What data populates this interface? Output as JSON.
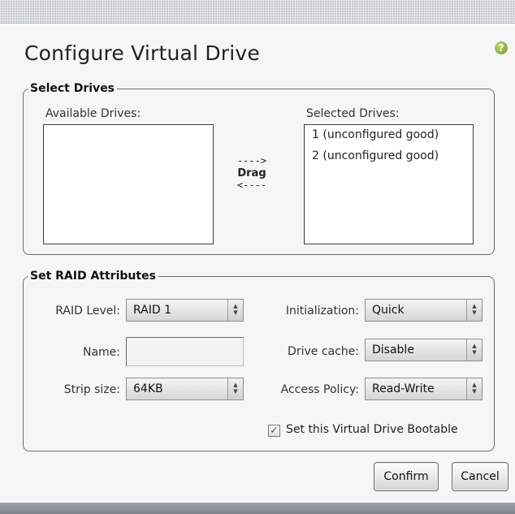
{
  "dialog": {
    "title": "Configure Virtual Drive",
    "help_icon_glyph": "?"
  },
  "select_drives": {
    "legend": "Select Drives",
    "available_label": "Available Drives:",
    "selected_label": "Selected Drives:",
    "available_items": [],
    "selected_items": [
      "1 (unconfigured good)",
      "2 (unconfigured good)"
    ],
    "drag_hint": {
      "arrow_right": "---->",
      "word": "Drag",
      "arrow_left": "<----"
    }
  },
  "raid_attributes": {
    "legend": "Set RAID Attributes",
    "raid_level": {
      "label": "RAID Level:",
      "value": "RAID 1"
    },
    "name": {
      "label": "Name:",
      "value": ""
    },
    "strip_size": {
      "label": "Strip size:",
      "value": "64KB"
    },
    "initialization": {
      "label": "Initialization:",
      "value": "Quick"
    },
    "drive_cache": {
      "label": "Drive cache:",
      "value": "Disable"
    },
    "access_policy": {
      "label": "Access Policy:",
      "value": "Read-Write"
    },
    "bootable": {
      "label": "Set this Virtual Drive Bootable",
      "checked": true,
      "check_glyph": "✓"
    }
  },
  "buttons": {
    "confirm": "Confirm",
    "cancel": "Cancel"
  },
  "icons": {
    "help": "help-icon",
    "spinner": "spinner-arrows-icon",
    "check": "check-icon"
  },
  "spinner_glyph": "▲\n▼",
  "colors": {
    "help_icon": "#7fa832",
    "dialog_bg": "#f6f6f6",
    "border": "#6f6f6f"
  }
}
